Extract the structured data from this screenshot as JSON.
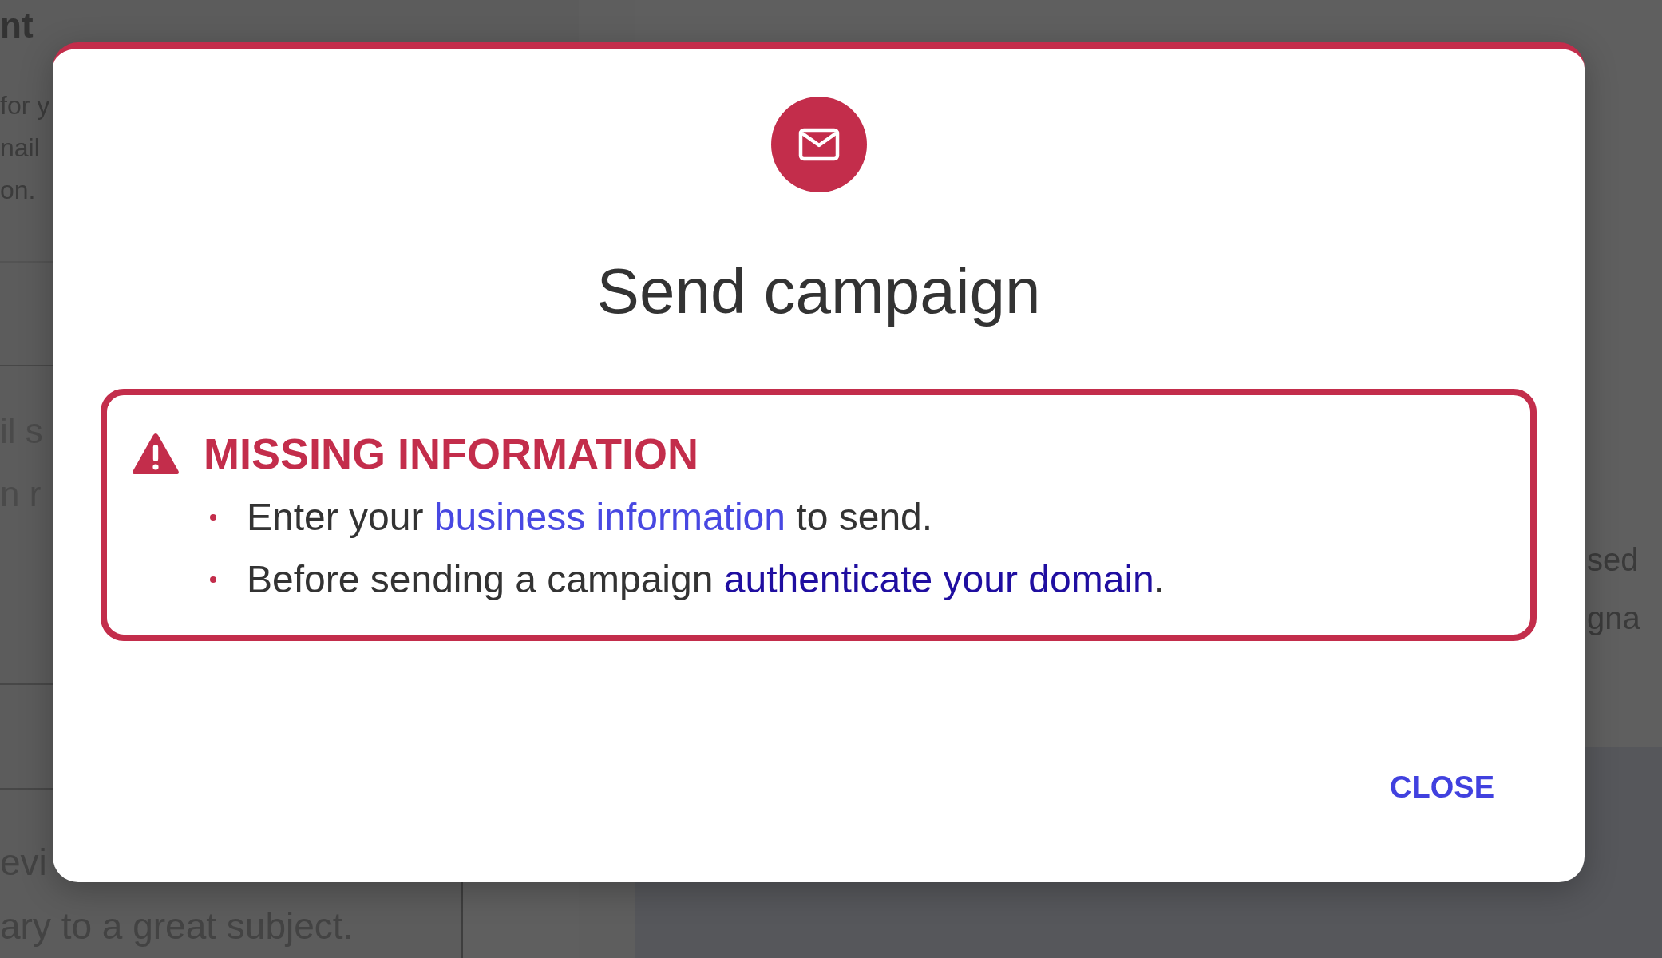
{
  "background_page": {
    "heading": "nt",
    "intro_lines": [
      "for y",
      "nail",
      "on."
    ],
    "section_lines": [
      "il s",
      "n r"
    ],
    "table_texts": [
      "evi",
      "ary to a great subject."
    ],
    "side_lines": [
      "sed",
      "gna"
    ]
  },
  "dialog": {
    "title": "Send campaign",
    "alert": {
      "title": "MISSING INFORMATION",
      "items": [
        {
          "parts": [
            {
              "kind": "text",
              "text": "Enter your "
            },
            {
              "kind": "link",
              "text": "business information",
              "visited": false
            },
            {
              "kind": "text",
              "text": " to send."
            }
          ]
        },
        {
          "parts": [
            {
              "kind": "text",
              "text": "Before sending a campaign "
            },
            {
              "kind": "link",
              "text": "authenticate your domain",
              "visited": true
            },
            {
              "kind": "text",
              "text": "."
            }
          ]
        }
      ]
    },
    "buttons": [
      {
        "label": "CLOSE"
      }
    ]
  }
}
